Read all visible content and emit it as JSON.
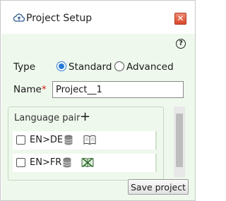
{
  "window": {
    "title": "Project Setup",
    "close_symbol": "✕",
    "help_symbol": "?"
  },
  "form": {
    "type_label": "Type",
    "type_options": [
      "Standard",
      "Advanced"
    ],
    "type_selected": "Standard",
    "name_label": "Name",
    "name_required_marker": "*",
    "name_value": "Project__1"
  },
  "language_pair": {
    "header": "Language pair",
    "add_symbol": "+",
    "rows": [
      {
        "pair": "EN>DE",
        "checked": false,
        "termbase_icon": "book-icon"
      },
      {
        "pair": "EN>FR",
        "checked": false,
        "termbase_icon": "book-crossed-icon"
      }
    ]
  },
  "buttons": {
    "save": "Save project"
  }
}
